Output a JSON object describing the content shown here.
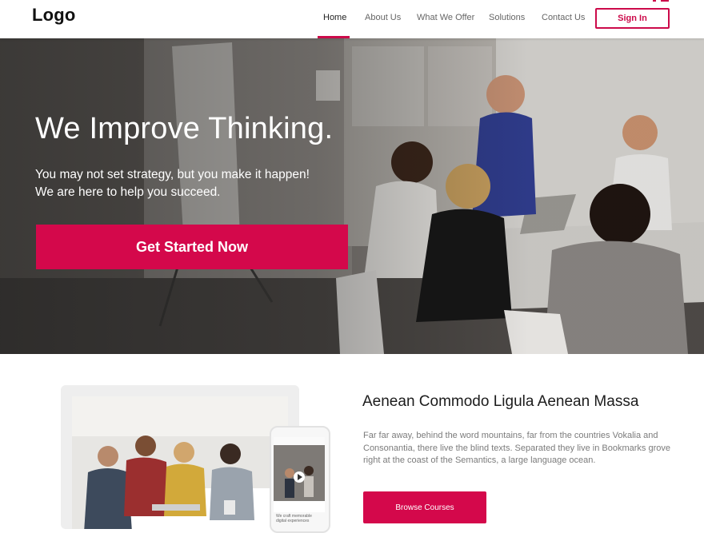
{
  "header": {
    "logo": "Logo",
    "nav": [
      {
        "label": "Home",
        "active": true
      },
      {
        "label": "About Us",
        "active": false
      },
      {
        "label": "What We Offer",
        "active": false
      },
      {
        "label": "Solutions",
        "active": false
      },
      {
        "label": "Contact Us",
        "active": false
      }
    ],
    "sign_in_label": "Sign In"
  },
  "hero": {
    "title": "We Improve Thinking.",
    "subtitle_line1": "You may not set strategy, but you make it happen!",
    "subtitle_line2": "We are here to help you succeed.",
    "cta_label": "Get Started Now",
    "image": "office-meeting-photo"
  },
  "feature": {
    "title": "Aenean Commodo Ligula Aenean Massa",
    "body": "Far far away, behind the word mountains, far from the countries Vokalia and Consonantia, there live the blind texts. Separated they live in Bookmarks grove right at the coast of the Semantics, a large language ocean.",
    "button_label": "Browse Courses",
    "phone_caption": "We craft memorable digital experiences",
    "device_image": "team-workshop-photo"
  },
  "colors": {
    "accent": "#d4084b",
    "text_dark": "#1c1c1c",
    "text_muted": "#7b7b7b"
  }
}
